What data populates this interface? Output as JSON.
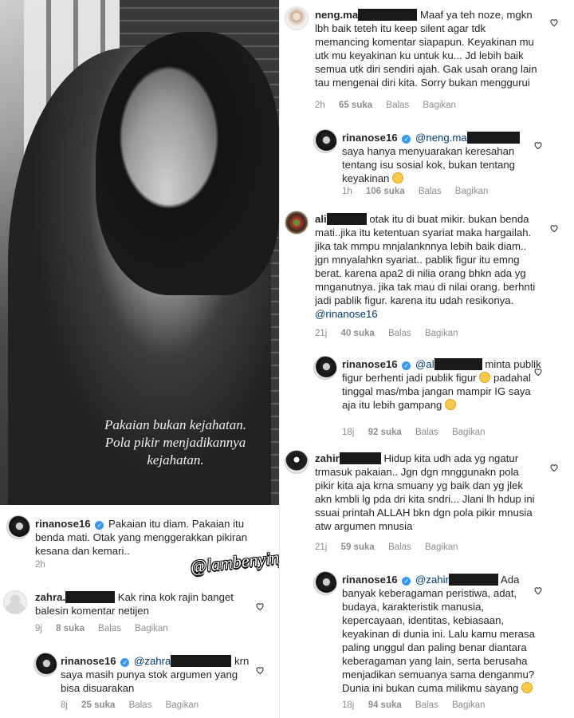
{
  "photo": {
    "quote_line1": "Pakaian bukan kejahatan.",
    "quote_line2": "Pola pikir menjadikannya",
    "quote_line3": "kejahatan."
  },
  "watermark": "@lambenyinyir",
  "post_caption": {
    "user": "rinanose16",
    "text": "Pakaian itu diam. Pakaian itu benda mati. Otak yang menggerakkan pikiran kesana dan kemari..",
    "time": "2h"
  },
  "labels": {
    "reply": "Balas",
    "share": "Bagikan"
  },
  "comments": {
    "zahra": {
      "user": "zahra.",
      "text": "Kak rina kok rajin banget balesin komentar netijen",
      "time": "9j",
      "likes": "8 suka"
    },
    "rina_zahra": {
      "user": "rinanose16",
      "mention": "@zahra",
      "text_after": "krn",
      "text": "saya masih punya stok argumen yang bisa disuarakan",
      "time": "8j",
      "likes": "25 suka"
    },
    "neng": {
      "user": "neng.ma",
      "text_after": "Maaf ya teh noze,",
      "text": "mgkn lbh baik teteh itu keep silent agar tdk memancing komentar siapapun. Keyakinan mu utk mu keyakinan ku untuk ku... Jd lebih baik semua utk diri sendiri ajah. Gak usah orang lain tau mengenai diri kita. Sorry bukan menggurui",
      "time": "2h",
      "likes": "65 suka"
    },
    "rina_neng": {
      "user": "rinanose16",
      "mention": "@neng.ma",
      "text": "saya hanya menyuarakan keresahan tentang isu sosial kok, bukan tentang keyakinan",
      "time": "1h",
      "likes": "106 suka"
    },
    "ali": {
      "user": "ali",
      "text_after": "otak itu di buat mikir. bukan",
      "text": "benda mati..jika itu ketentuan syariat maka hargailah. jika tak mmpu mnjalanknnya lebih baik diam.. jgn mnyalahkn syariat.. pablik figur itu emng berat. karena apa2 di nilia orang bhkn ada yg mnganutnya. jika tak mau di nilai orang. berhnti jadi pablik figur. karena itu udah resikonya.",
      "mention_end": "@rinanose16",
      "time": "21j",
      "likes": "40 suka"
    },
    "rina_ali": {
      "user": "rinanose16",
      "mention": "@al",
      "text_after": "minta",
      "text": "publik figur berhenti jadi publik figur",
      "text2": "padahal tinggal mas/mba jangan mampir IG saya aja itu lebih gampang",
      "time": "18j",
      "likes": "92 suka"
    },
    "zahir": {
      "user": "zahir",
      "text_after": "Hidup kita udh ada yg",
      "text": "ngatur trmasuk pakaian.. Jgn dgn mnggunakn pola pikir kita aja krna smuany yg baik dan yg jlek akn kmbli lg pda dri kita sndri... Jlani lh hdup ini ssuai printah ALLAH bkn dgn pola pikir mnusia atw argumen mnusia",
      "time": "21j",
      "likes": "59 suka"
    },
    "rina_zahir": {
      "user": "rinanose16",
      "mention": "@zahir",
      "text_after": "Ada",
      "text": "banyak keberagaman peristiwa, adat, budaya, karakteristik manusia, kepercayaan, identitas, kebiasaan, keyakinan di dunia ini. Lalu kamu merasa paling unggul dan paling benar diantara keberagaman yang lain, serta berusaha menjadikan semuanya sama denganmu? Dunia ini bukan cuma milikmu sayang",
      "time": "18j",
      "likes": "94 suka"
    }
  }
}
